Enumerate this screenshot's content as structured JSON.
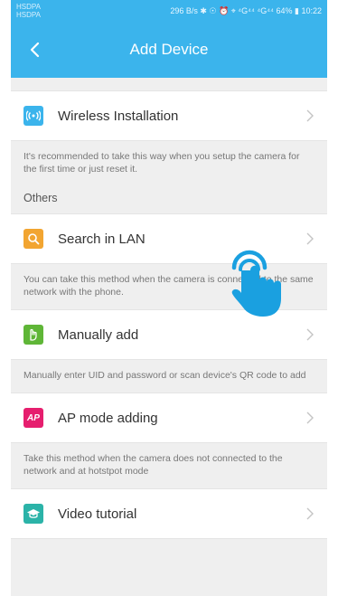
{
  "status": {
    "left_top": "HSDPA",
    "left_bottom": "HSDPA",
    "right": "296 B/s ✱ ☉ ⏰ ⌖ ⁴G⁴⁴ ⁴G⁴⁴ 64% ▮ 10:22"
  },
  "header": {
    "title": "Add Device"
  },
  "items": [
    {
      "label": "Wireless Installation",
      "icon": "wifi-signal-icon",
      "color": "#3bb4ec",
      "desc": "It's recommended to take this way when you setup the camera for the first time or just reset it."
    }
  ],
  "section_label": "Others",
  "others": [
    {
      "label": "Search in LAN",
      "icon": "search-icon",
      "color": "#f2a531",
      "desc": "You can take this method when the camera is connected to the same network with the phone."
    },
    {
      "label": "Manually add",
      "icon": "hand-icon",
      "color": "#5fb637",
      "desc": "Manually enter UID and password or scan device's QR code to add"
    },
    {
      "label": "AP mode adding",
      "icon": "ap-icon",
      "color": "#e61e6e",
      "badge": "AP",
      "desc": "Take this method when the camera does not connected to the network and at hotstpot mode"
    },
    {
      "label": "Video tutorial",
      "icon": "graduation-cap-icon",
      "color": "#2bb3a8"
    }
  ]
}
